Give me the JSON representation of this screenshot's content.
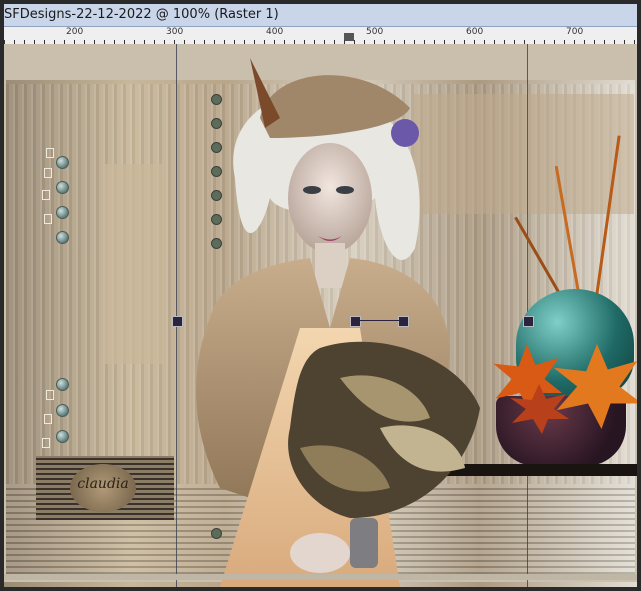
{
  "window": {
    "title": "SFDesigns-22-12-2022 @ 100% (Raster 1)"
  },
  "ruler": {
    "labels": [
      "200",
      "300",
      "400",
      "500",
      "600",
      "700"
    ]
  },
  "watermark": {
    "text": "claudia"
  },
  "colors": {
    "vase": "#1f6a66",
    "leaves": "#e2791e",
    "titlebar": "#c9d6ea"
  }
}
